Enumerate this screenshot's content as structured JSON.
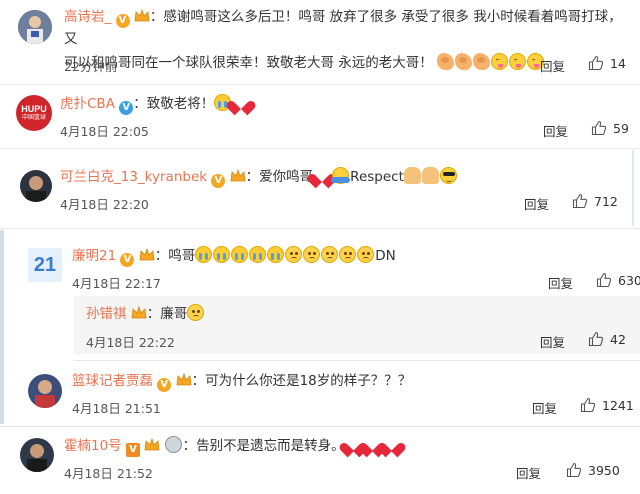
{
  "colors": {
    "username": "#eb7350",
    "text": "#333333",
    "meta": "#555555",
    "divider": "#e6e6e6",
    "reply_bg": "#f5f5f5"
  },
  "labels": {
    "reply": "回复"
  },
  "comments": [
    {
      "username": "高诗岩_",
      "badges": [
        "v-gold",
        "crown"
      ],
      "text_line1": "感谢鸣哥这么多后卫！鸣哥 放弃了很多 承受了很多 我小时候看着鸣哥打球，又",
      "text_line2": "可以和鸣哥同在一个球队很荣幸！致敬老大哥 永远的老大哥！",
      "emojis": [
        "arm-icon",
        "arm-icon",
        "arm-icon",
        "yum-icon",
        "yum-icon",
        "yum-icon"
      ],
      "time": "22分钟前",
      "likes": "14"
    },
    {
      "username": "虎扑CBA",
      "badges": [
        "v-blue"
      ],
      "text": "致敬老将！",
      "emojis": [
        "cry-icon",
        "heart-icon"
      ],
      "avatar_text1": "HUPU",
      "avatar_text2": "中国篮球",
      "time": "4月18日 22:05",
      "likes": "59"
    },
    {
      "username": "可兰白克_13_kyranbek",
      "badges": [
        "v-gold",
        "crown"
      ],
      "text": "爱你鸣哥",
      "text2": "Respect",
      "emojis": [
        "heart-icon",
        "hug-icon",
        "pray-icon",
        "pray-icon",
        "cool-icon"
      ],
      "time": "4月18日 22:20",
      "likes": "712"
    },
    {
      "username": "廉明21",
      "badges": [
        "v-gold",
        "crown"
      ],
      "text": "鸣哥",
      "text_end": "DN",
      "emojis": [
        "cry-icon",
        "cry-icon",
        "cry-icon",
        "cry-icon",
        "cry-icon",
        "sad-icon",
        "sad-icon",
        "sad-icon",
        "sad-icon",
        "sad-icon"
      ],
      "avatar_text": "21",
      "time": "4月18日 22:17",
      "likes": "630"
    },
    {
      "username": "孙错祺",
      "badges": [
        "crown"
      ],
      "text": "廉哥",
      "emojis": [
        "sad-icon"
      ],
      "time": "4月18日 22:22",
      "likes": "42"
    },
    {
      "username": "篮球记者贾磊",
      "badges": [
        "v-gold",
        "crown"
      ],
      "text": "可为什么你还是18岁的样子？？？",
      "time": "4月18日 21:51",
      "likes": "1241"
    },
    {
      "username": "霍楠10号",
      "badges": [
        "v-orange",
        "crown",
        "stopwatch"
      ],
      "text": "告别不是遗忘而是转身。",
      "emojis": [
        "heart-icon",
        "heart-icon",
        "heart-icon"
      ],
      "time": "4月18日 21:52",
      "likes": "3950"
    }
  ]
}
